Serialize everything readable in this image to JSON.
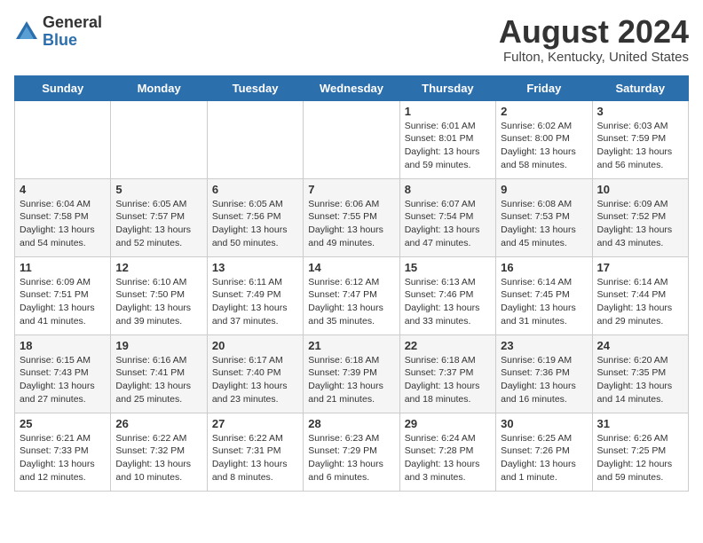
{
  "header": {
    "logo": {
      "general": "General",
      "blue": "Blue"
    },
    "month_year": "August 2024",
    "location": "Fulton, Kentucky, United States"
  },
  "days_of_week": [
    "Sunday",
    "Monday",
    "Tuesday",
    "Wednesday",
    "Thursday",
    "Friday",
    "Saturday"
  ],
  "weeks": [
    [
      {
        "day": "",
        "info": ""
      },
      {
        "day": "",
        "info": ""
      },
      {
        "day": "",
        "info": ""
      },
      {
        "day": "",
        "info": ""
      },
      {
        "day": "1",
        "info": "Sunrise: 6:01 AM\nSunset: 8:01 PM\nDaylight: 13 hours\nand 59 minutes."
      },
      {
        "day": "2",
        "info": "Sunrise: 6:02 AM\nSunset: 8:00 PM\nDaylight: 13 hours\nand 58 minutes."
      },
      {
        "day": "3",
        "info": "Sunrise: 6:03 AM\nSunset: 7:59 PM\nDaylight: 13 hours\nand 56 minutes."
      }
    ],
    [
      {
        "day": "4",
        "info": "Sunrise: 6:04 AM\nSunset: 7:58 PM\nDaylight: 13 hours\nand 54 minutes."
      },
      {
        "day": "5",
        "info": "Sunrise: 6:05 AM\nSunset: 7:57 PM\nDaylight: 13 hours\nand 52 minutes."
      },
      {
        "day": "6",
        "info": "Sunrise: 6:05 AM\nSunset: 7:56 PM\nDaylight: 13 hours\nand 50 minutes."
      },
      {
        "day": "7",
        "info": "Sunrise: 6:06 AM\nSunset: 7:55 PM\nDaylight: 13 hours\nand 49 minutes."
      },
      {
        "day": "8",
        "info": "Sunrise: 6:07 AM\nSunset: 7:54 PM\nDaylight: 13 hours\nand 47 minutes."
      },
      {
        "day": "9",
        "info": "Sunrise: 6:08 AM\nSunset: 7:53 PM\nDaylight: 13 hours\nand 45 minutes."
      },
      {
        "day": "10",
        "info": "Sunrise: 6:09 AM\nSunset: 7:52 PM\nDaylight: 13 hours\nand 43 minutes."
      }
    ],
    [
      {
        "day": "11",
        "info": "Sunrise: 6:09 AM\nSunset: 7:51 PM\nDaylight: 13 hours\nand 41 minutes."
      },
      {
        "day": "12",
        "info": "Sunrise: 6:10 AM\nSunset: 7:50 PM\nDaylight: 13 hours\nand 39 minutes."
      },
      {
        "day": "13",
        "info": "Sunrise: 6:11 AM\nSunset: 7:49 PM\nDaylight: 13 hours\nand 37 minutes."
      },
      {
        "day": "14",
        "info": "Sunrise: 6:12 AM\nSunset: 7:47 PM\nDaylight: 13 hours\nand 35 minutes."
      },
      {
        "day": "15",
        "info": "Sunrise: 6:13 AM\nSunset: 7:46 PM\nDaylight: 13 hours\nand 33 minutes."
      },
      {
        "day": "16",
        "info": "Sunrise: 6:14 AM\nSunset: 7:45 PM\nDaylight: 13 hours\nand 31 minutes."
      },
      {
        "day": "17",
        "info": "Sunrise: 6:14 AM\nSunset: 7:44 PM\nDaylight: 13 hours\nand 29 minutes."
      }
    ],
    [
      {
        "day": "18",
        "info": "Sunrise: 6:15 AM\nSunset: 7:43 PM\nDaylight: 13 hours\nand 27 minutes."
      },
      {
        "day": "19",
        "info": "Sunrise: 6:16 AM\nSunset: 7:41 PM\nDaylight: 13 hours\nand 25 minutes."
      },
      {
        "day": "20",
        "info": "Sunrise: 6:17 AM\nSunset: 7:40 PM\nDaylight: 13 hours\nand 23 minutes."
      },
      {
        "day": "21",
        "info": "Sunrise: 6:18 AM\nSunset: 7:39 PM\nDaylight: 13 hours\nand 21 minutes."
      },
      {
        "day": "22",
        "info": "Sunrise: 6:18 AM\nSunset: 7:37 PM\nDaylight: 13 hours\nand 18 minutes."
      },
      {
        "day": "23",
        "info": "Sunrise: 6:19 AM\nSunset: 7:36 PM\nDaylight: 13 hours\nand 16 minutes."
      },
      {
        "day": "24",
        "info": "Sunrise: 6:20 AM\nSunset: 7:35 PM\nDaylight: 13 hours\nand 14 minutes."
      }
    ],
    [
      {
        "day": "25",
        "info": "Sunrise: 6:21 AM\nSunset: 7:33 PM\nDaylight: 13 hours\nand 12 minutes."
      },
      {
        "day": "26",
        "info": "Sunrise: 6:22 AM\nSunset: 7:32 PM\nDaylight: 13 hours\nand 10 minutes."
      },
      {
        "day": "27",
        "info": "Sunrise: 6:22 AM\nSunset: 7:31 PM\nDaylight: 13 hours\nand 8 minutes."
      },
      {
        "day": "28",
        "info": "Sunrise: 6:23 AM\nSunset: 7:29 PM\nDaylight: 13 hours\nand 6 minutes."
      },
      {
        "day": "29",
        "info": "Sunrise: 6:24 AM\nSunset: 7:28 PM\nDaylight: 13 hours\nand 3 minutes."
      },
      {
        "day": "30",
        "info": "Sunrise: 6:25 AM\nSunset: 7:26 PM\nDaylight: 13 hours\nand 1 minute."
      },
      {
        "day": "31",
        "info": "Sunrise: 6:26 AM\nSunset: 7:25 PM\nDaylight: 12 hours\nand 59 minutes."
      }
    ]
  ]
}
